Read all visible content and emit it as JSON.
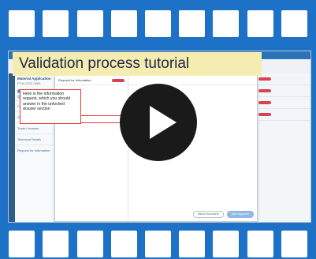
{
  "video": {
    "title": "Validation process tutorial",
    "play_icon": "play-icon"
  },
  "app": {
    "sidebar_title": "Material Application",
    "sidebar_subtitle": "FCW-2022-0666",
    "sidebar_items": [
      "Contacts",
      "General Data",
      "Trade Licenses",
      "Technical Details",
      "Request for information"
    ],
    "dialog_header": "Request for information",
    "callout_text": "Here is the information request, which you should answer in the unlocked dossier section",
    "footer_buttons": [
      "Attach document",
      "Add response"
    ]
  },
  "colors": {
    "frame_blue": "#1d72c8",
    "caption_bg": "#f5ecb2",
    "play_bg": "#1a1a1a",
    "callout_border": "#e33b3b"
  }
}
